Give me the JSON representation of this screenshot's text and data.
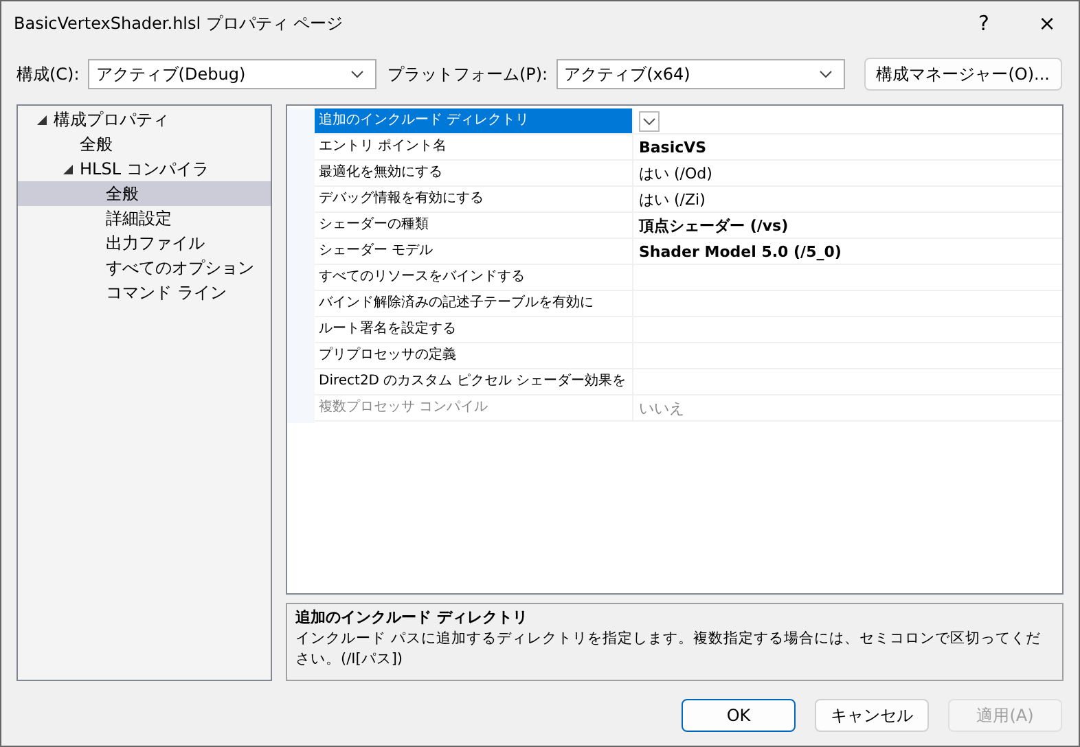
{
  "window": {
    "title": "BasicVertexShader.hlsl プロパティ ページ",
    "help": "?",
    "close": "×"
  },
  "config": {
    "label": "構成(C):",
    "value": "アクティブ(Debug)"
  },
  "platform": {
    "label": "プラットフォーム(P):",
    "value": "アクティブ(x64)"
  },
  "config_manager": "構成マネージャー(O)...",
  "tree": [
    {
      "label": "構成プロパティ",
      "expanded": true,
      "selected": false,
      "children": [
        {
          "label": "全般",
          "selected": false
        },
        {
          "label": "HLSL コンパイラ",
          "expanded": true,
          "selected": false,
          "children": [
            {
              "label": "全般",
              "selected": true
            },
            {
              "label": "詳細設定",
              "selected": false
            },
            {
              "label": "出力ファイル",
              "selected": false
            },
            {
              "label": "すべてのオプション",
              "selected": false
            },
            {
              "label": "コマンド ライン",
              "selected": false
            }
          ]
        }
      ]
    }
  ],
  "properties": [
    {
      "name": "追加のインクルード ディレクトリ",
      "selected": true,
      "modified": false,
      "disabled": false
    },
    {
      "name": "エントリ ポイント名",
      "value": "BasicVS",
      "selected": false,
      "modified": true,
      "disabled": false
    },
    {
      "name": "最適化を無効にする",
      "value": "はい (/Od)",
      "selected": false,
      "modified": false,
      "disabled": false
    },
    {
      "name": "デバッグ情報を有効にする",
      "value": "はい (/Zi)",
      "selected": false,
      "modified": false,
      "disabled": false
    },
    {
      "name": "シェーダーの種類",
      "value": "頂点シェーダー (/vs)",
      "selected": false,
      "modified": true,
      "disabled": false
    },
    {
      "name": "シェーダー モデル",
      "value": "Shader Model 5.0 (/5_0)",
      "selected": false,
      "modified": true,
      "disabled": false
    },
    {
      "name": "すべてのリソースをバインドする",
      "selected": false,
      "modified": false,
      "disabled": false
    },
    {
      "name": "バインド解除済みの記述子テーブルを有効に",
      "selected": false,
      "modified": false,
      "disabled": false
    },
    {
      "name": "ルート署名を設定する",
      "selected": false,
      "modified": false,
      "disabled": false
    },
    {
      "name": "プリプロセッサの定義",
      "selected": false,
      "modified": false,
      "disabled": false
    },
    {
      "name": "Direct2D のカスタム ピクセル シェーダー効果を",
      "selected": false,
      "modified": false,
      "disabled": false
    },
    {
      "name": "複数プロセッサ コンパイル",
      "value": "いいえ",
      "selected": false,
      "modified": false,
      "disabled": true
    }
  ],
  "description": {
    "title": "追加のインクルード ディレクトリ",
    "text": "インクルード パスに追加するディレクトリを指定します。複数指定する場合には、セミコロンで区切ってください。(/I[パス])"
  },
  "buttons": [
    {
      "label": "OK",
      "kind": "default",
      "disabled": false
    },
    {
      "label": "キャンセル",
      "kind": "normal",
      "disabled": false
    },
    {
      "label": "適用(A)",
      "kind": "normal",
      "disabled": true
    }
  ]
}
